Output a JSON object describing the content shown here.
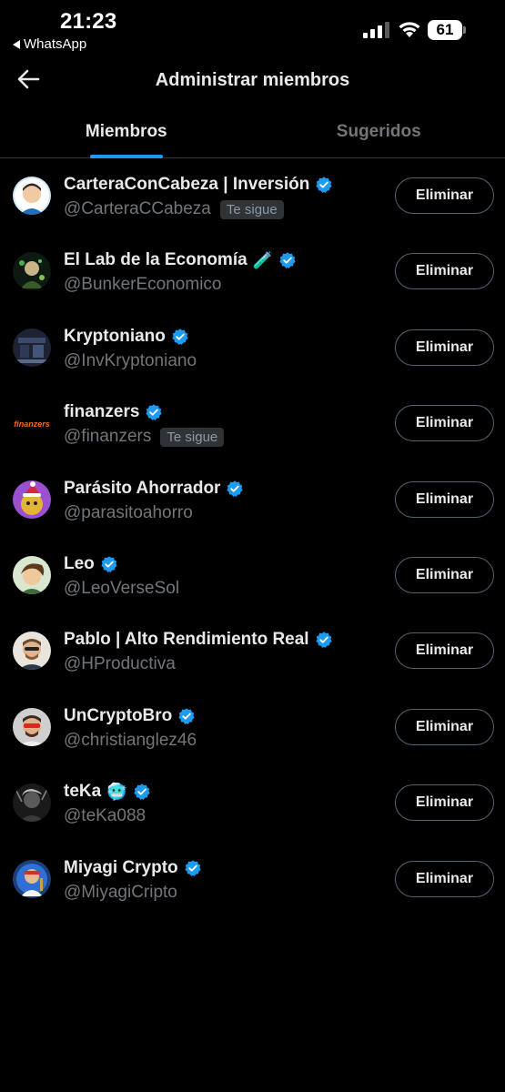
{
  "status_bar": {
    "time": "21:23",
    "back_app": "WhatsApp",
    "battery": "61",
    "icons": [
      "signal-icon",
      "wifi-icon",
      "battery-icon"
    ]
  },
  "header": {
    "back_icon": "arrow-left-icon",
    "title": "Administrar miembros"
  },
  "tabs": [
    {
      "label": "Miembros",
      "active": true
    },
    {
      "label": "Sugeridos",
      "active": false
    }
  ],
  "colors": {
    "background": "#000000",
    "accent": "#1d9bf0",
    "secondary_text": "#71767b"
  },
  "members": [
    {
      "name": "CarteraConCabeza | Inversión",
      "emoji": "",
      "handle": "@CarteraCCabeza",
      "follows_you": "Te sigue",
      "verified": true,
      "button": "Eliminar"
    },
    {
      "name": "El Lab de la Economía",
      "emoji": "🧪",
      "handle": "@BunkerEconomico",
      "follows_you": "",
      "verified": true,
      "button": "Eliminar"
    },
    {
      "name": "Kryptoniano",
      "emoji": "",
      "handle": "@InvKryptoniano",
      "follows_you": "",
      "verified": true,
      "button": "Eliminar"
    },
    {
      "name": "finanzers",
      "emoji": "",
      "handle": "@finanzers",
      "follows_you": "Te sigue",
      "verified": true,
      "button": "Eliminar",
      "avatar_text": "finanzers"
    },
    {
      "name": "Parásito Ahorrador",
      "emoji": "",
      "handle": "@parasitoahorro",
      "follows_you": "",
      "verified": true,
      "button": "Eliminar"
    },
    {
      "name": "Leo",
      "emoji": "",
      "handle": "@LeoVerseSol",
      "follows_you": "",
      "verified": true,
      "button": "Eliminar"
    },
    {
      "name": "Pablo | Alto Rendimiento Real",
      "emoji": "",
      "handle": "@HProductiva",
      "follows_you": "",
      "verified": true,
      "button": "Eliminar"
    },
    {
      "name": "UnCryptoBro",
      "emoji": "",
      "handle": "@christianglez46",
      "follows_you": "",
      "verified": true,
      "button": "Eliminar"
    },
    {
      "name": "teKa",
      "emoji": "🥶",
      "handle": "@teKa088",
      "follows_you": "",
      "verified": true,
      "button": "Eliminar"
    },
    {
      "name": "Miyagi Crypto",
      "emoji": "",
      "handle": "@MiyagiCripto",
      "follows_you": "",
      "verified": true,
      "button": "Eliminar"
    }
  ]
}
